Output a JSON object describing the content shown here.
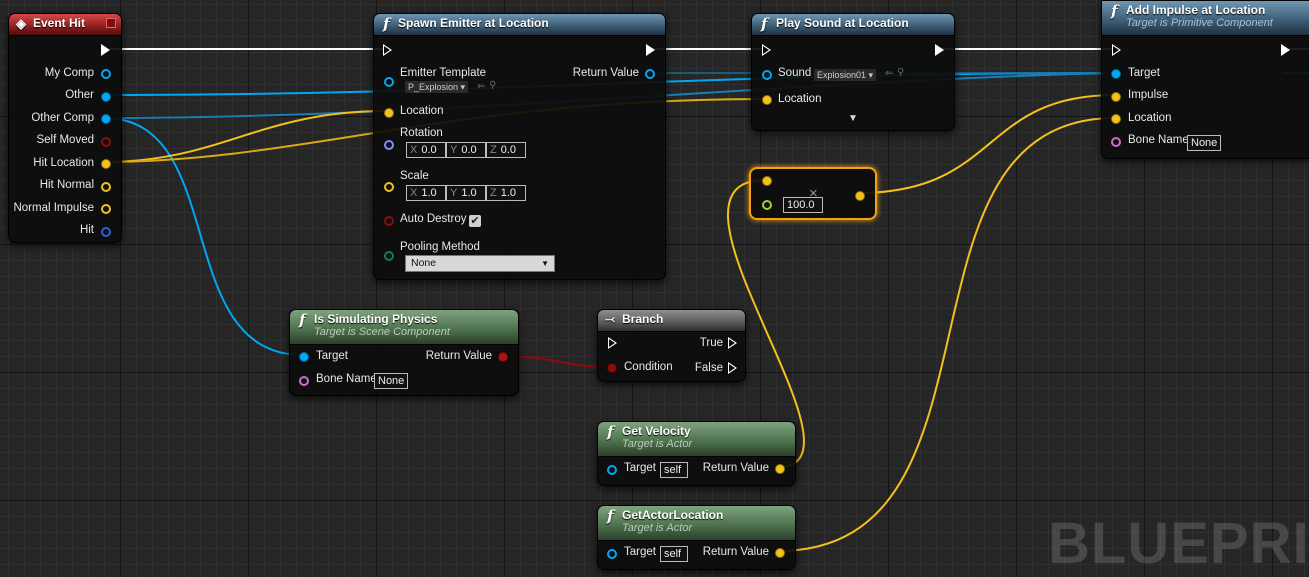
{
  "watermark": "BLUEPRIN",
  "colors": {
    "exec": "#ffffff",
    "object": "#00a8f3",
    "vector": "#f4c01c",
    "bool": "#8f0c0c",
    "float": "#9ad32c",
    "struct": "#7a7aff",
    "string": "#d46bd4"
  },
  "event_hit": {
    "title": "Event Hit",
    "pins": [
      "My Comp",
      "Other",
      "Other Comp",
      "Self Moved",
      "Hit Location",
      "Hit Normal",
      "Normal Impulse",
      "Hit"
    ]
  },
  "spawn_emitter": {
    "title": "Spawn Emitter at Location",
    "emitter_template_label": "Emitter Template",
    "emitter_template_value": "P_Explosion",
    "return_value_label": "Return Value",
    "location_label": "Location",
    "rotation_label": "Rotation",
    "rotation": {
      "x": "0.0",
      "y": "0.0",
      "z": "0.0"
    },
    "scale_label": "Scale",
    "scale": {
      "x": "1.0",
      "y": "1.0",
      "z": "1.0"
    },
    "auto_destroy_label": "Auto Destroy",
    "pooling_method_label": "Pooling Method",
    "pooling_method_value": "None",
    "axis": {
      "x": "X",
      "y": "Y",
      "z": "Z"
    }
  },
  "play_sound": {
    "title": "Play Sound at Location",
    "sound_label": "Sound",
    "sound_value": "Explosion01",
    "location_label": "Location"
  },
  "add_impulse": {
    "title": "Add Impulse at Location",
    "subtitle": "Target is Primitive Component",
    "target_label": "Target",
    "impulse_label": "Impulse",
    "location_label": "Location",
    "bone_name_label": "Bone Name",
    "bone_name_value": "None"
  },
  "multiply": {
    "symbol": "×",
    "value": "100.0"
  },
  "is_simulating": {
    "title": "Is Simulating Physics",
    "subtitle": "Target is Scene Component",
    "target_label": "Target",
    "return_value_label": "Return Value",
    "bone_name_label": "Bone Name",
    "bone_name_value": "None"
  },
  "branch": {
    "title": "Branch",
    "true_label": "True",
    "condition_label": "Condition",
    "false_label": "False"
  },
  "get_velocity": {
    "title": "Get Velocity",
    "subtitle": "Target is Actor",
    "target_label": "Target",
    "target_value": "self",
    "return_value_label": "Return Value"
  },
  "get_actor_location": {
    "title": "GetActorLocation",
    "subtitle": "Target is Actor",
    "target_label": "Target",
    "target_value": "self",
    "return_value_label": "Return Value"
  }
}
